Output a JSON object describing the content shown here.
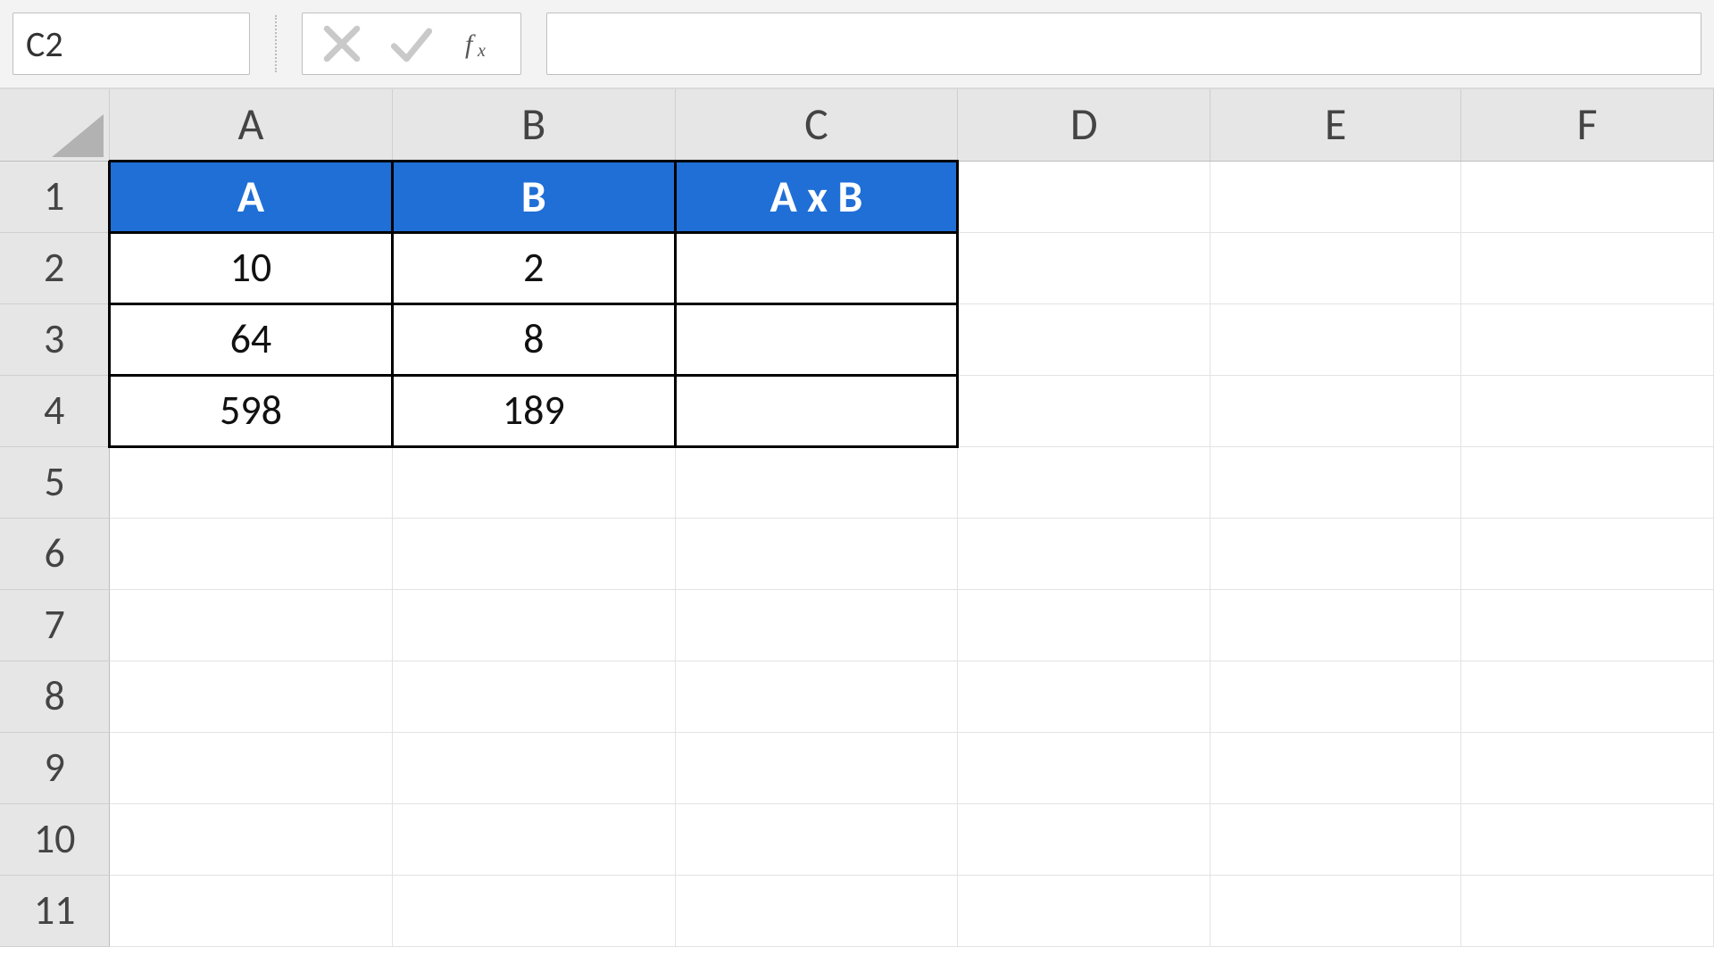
{
  "formula_bar": {
    "name_box_value": "C2",
    "formula_value": ""
  },
  "columns": [
    "A",
    "B",
    "C",
    "D",
    "E",
    "F"
  ],
  "row_numbers": [
    "1",
    "2",
    "3",
    "4",
    "5",
    "6",
    "7",
    "8",
    "9",
    "10",
    "11"
  ],
  "table": {
    "headers": {
      "A": "A",
      "B": "B",
      "C": "A x B"
    },
    "rows": [
      {
        "A": "10",
        "B": "2",
        "C": ""
      },
      {
        "A": "64",
        "B": "8",
        "C": ""
      },
      {
        "A": "598",
        "B": "189",
        "C": ""
      }
    ]
  },
  "colors": {
    "header_fill": "#1f6fd6",
    "header_text": "#ffffff"
  },
  "selected_cell": "C2"
}
